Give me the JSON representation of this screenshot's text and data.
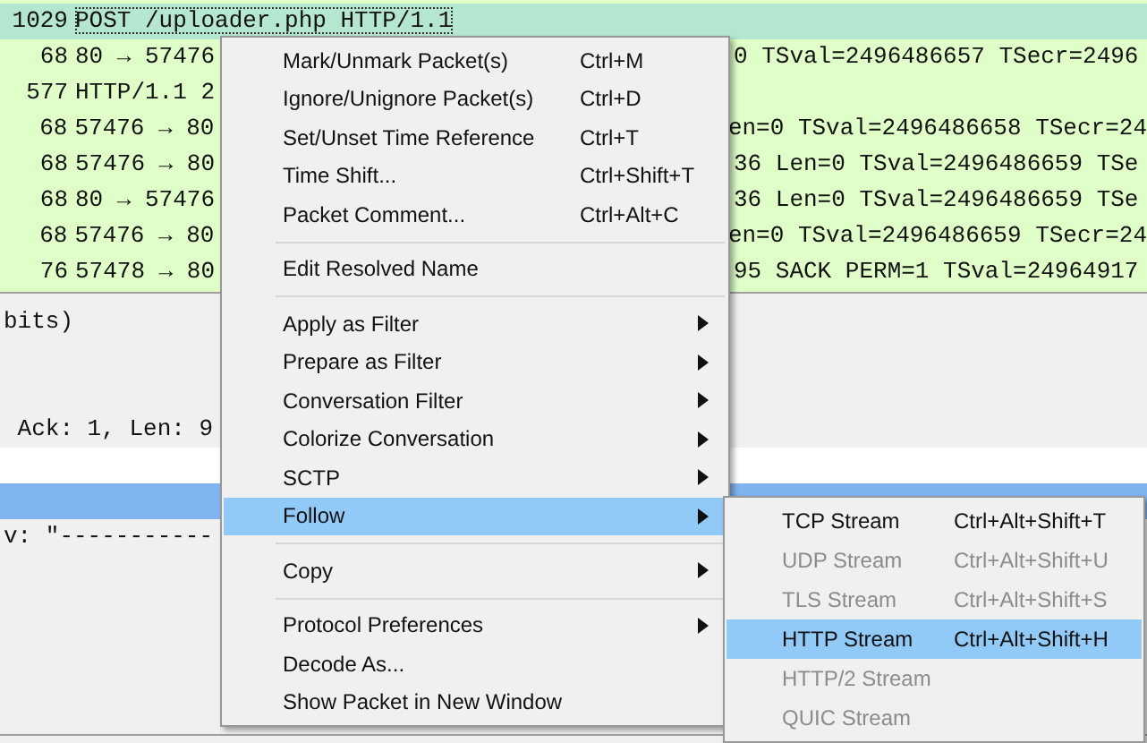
{
  "packet_list": {
    "rows": [
      {
        "length": "1029",
        "info_left": "POST /uploader.php HTTP/1.1",
        "info_right": "",
        "selected": true
      },
      {
        "length": "68",
        "info_left": "80 → 57476",
        "info_right": "0 TSval=2496486657 TSecr=2496",
        "selected": false
      },
      {
        "length": "577",
        "info_left": "HTTP/1.1 2",
        "info_right": "",
        "selected": false
      },
      {
        "length": "68",
        "info_left": "57476 → 80",
        "info_right": "en=0 TSval=2496486658 TSecr=24",
        "selected": false
      },
      {
        "length": "68",
        "info_left": "57476 → 80",
        "info_right": "36 Len=0 TSval=2496486659 TSe",
        "selected": false
      },
      {
        "length": "68",
        "info_left": "80 → 57476",
        "info_right": "36 Len=0 TSval=2496486659 TSe",
        "selected": false
      },
      {
        "length": "68",
        "info_left": "57476 → 80",
        "info_right": "en=0 TSval=2496486659 TSecr=24",
        "selected": false
      },
      {
        "length": "76",
        "info_left": "57478 → 80",
        "info_right": "95 SACK PERM=1 TSval=24964917",
        "selected": false
      }
    ]
  },
  "packet_details": {
    "lines": [
      {
        "kind": "text",
        "text": "bits)",
        "selected": false
      },
      {
        "kind": "text",
        "text": " Ack: 1, Len: 9",
        "selected": false
      },
      {
        "kind": "blank",
        "selected": false
      },
      {
        "kind": "blank",
        "selected": true
      },
      {
        "kind": "text",
        "text": "v: \"-----------",
        "selected": false
      }
    ]
  },
  "context_menu": {
    "items": [
      {
        "kind": "item",
        "label": "Mark/Unmark Packet(s)",
        "shortcut": "Ctrl+M",
        "submenu": false,
        "selected": false
      },
      {
        "kind": "item",
        "label": "Ignore/Unignore Packet(s)",
        "shortcut": "Ctrl+D",
        "submenu": false,
        "selected": false
      },
      {
        "kind": "item",
        "label": "Set/Unset Time Reference",
        "shortcut": "Ctrl+T",
        "submenu": false,
        "selected": false
      },
      {
        "kind": "item",
        "label": "Time Shift...",
        "shortcut": "Ctrl+Shift+T",
        "submenu": false,
        "selected": false
      },
      {
        "kind": "item",
        "label": "Packet Comment...",
        "shortcut": "Ctrl+Alt+C",
        "submenu": false,
        "selected": false
      },
      {
        "kind": "separator"
      },
      {
        "kind": "item",
        "label": "Edit Resolved Name",
        "submenu": false,
        "selected": false
      },
      {
        "kind": "separator"
      },
      {
        "kind": "item",
        "label": "Apply as Filter",
        "submenu": true,
        "selected": false
      },
      {
        "kind": "item",
        "label": "Prepare as Filter",
        "submenu": true,
        "selected": false
      },
      {
        "kind": "item",
        "label": "Conversation Filter",
        "submenu": true,
        "selected": false
      },
      {
        "kind": "item",
        "label": "Colorize Conversation",
        "submenu": true,
        "selected": false
      },
      {
        "kind": "item",
        "label": "SCTP",
        "submenu": true,
        "selected": false
      },
      {
        "kind": "item",
        "label": "Follow",
        "submenu": true,
        "selected": true
      },
      {
        "kind": "separator"
      },
      {
        "kind": "item",
        "label": "Copy",
        "submenu": true,
        "selected": false
      },
      {
        "kind": "separator"
      },
      {
        "kind": "item",
        "label": "Protocol Preferences",
        "submenu": true,
        "selected": false
      },
      {
        "kind": "item",
        "label": "Decode As...",
        "submenu": false,
        "selected": false
      },
      {
        "kind": "item",
        "label": "Show Packet in New Window",
        "submenu": false,
        "selected": false
      }
    ]
  },
  "follow_submenu": {
    "items": [
      {
        "label": "TCP Stream",
        "shortcut": "Ctrl+Alt+Shift+T",
        "disabled": false,
        "selected": false
      },
      {
        "label": "UDP Stream",
        "shortcut": "Ctrl+Alt+Shift+U",
        "disabled": true,
        "selected": false
      },
      {
        "label": "TLS Stream",
        "shortcut": "Ctrl+Alt+Shift+S",
        "disabled": true,
        "selected": false
      },
      {
        "label": "HTTP Stream",
        "shortcut": "Ctrl+Alt+Shift+H",
        "disabled": false,
        "selected": true
      },
      {
        "label": "HTTP/2 Stream",
        "disabled": true,
        "selected": false
      },
      {
        "label": "QUIC Stream",
        "disabled": true,
        "selected": false
      }
    ]
  }
}
